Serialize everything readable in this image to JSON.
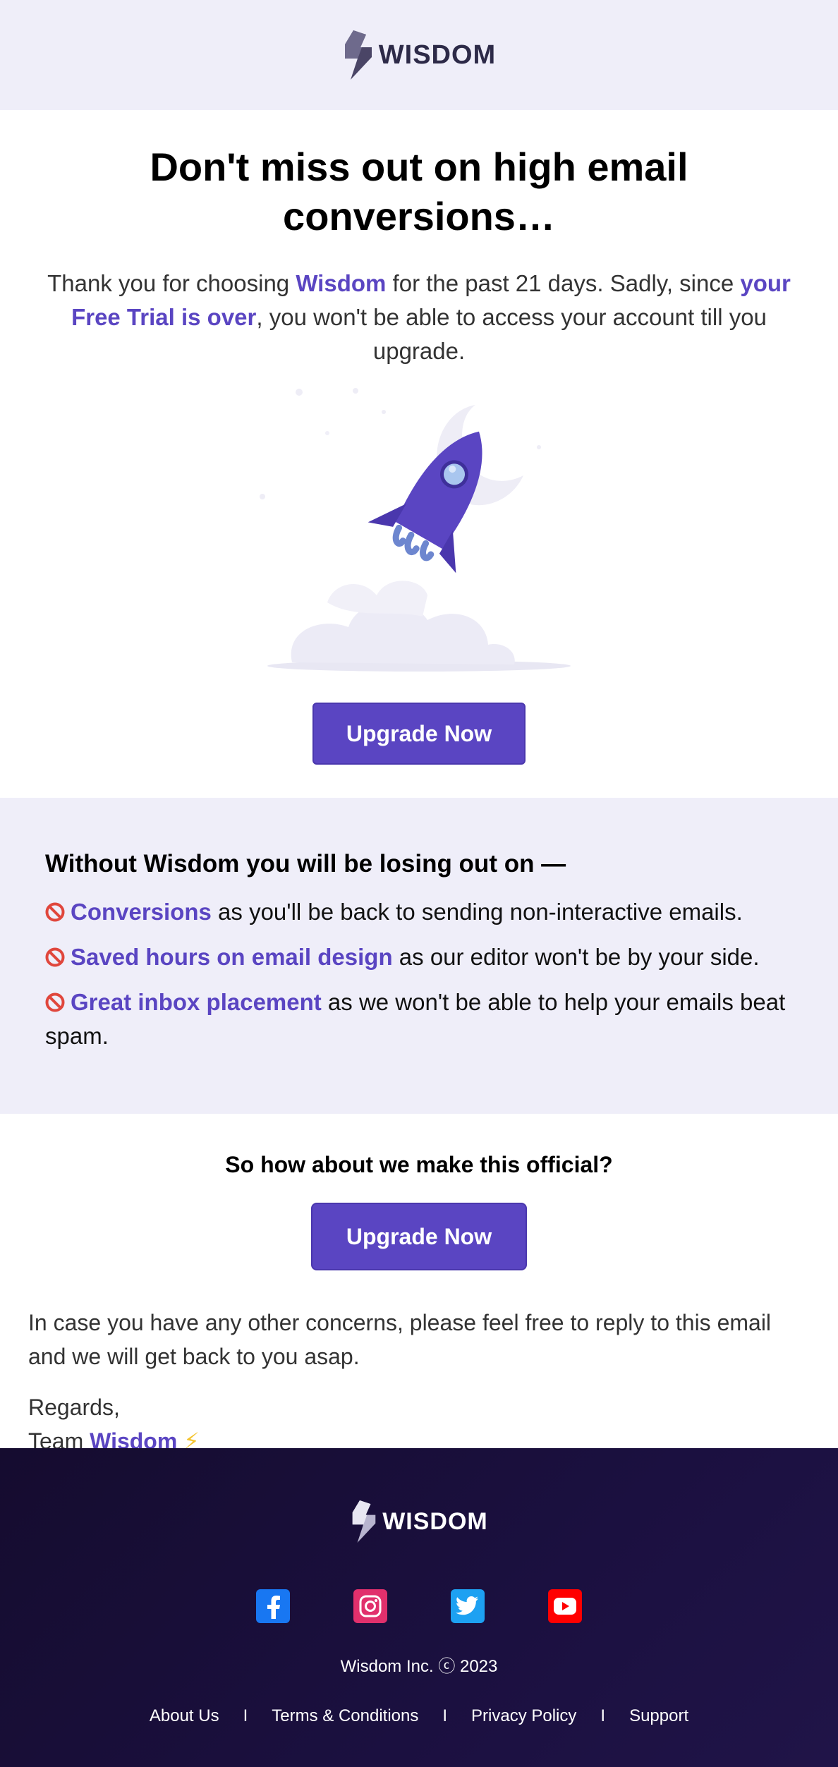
{
  "header": {
    "logo_text": "WISDOM"
  },
  "hero": {
    "title_line1": "Don't miss out on high email",
    "title_line2": "conversions…",
    "intro_part1": "Thank you for choosing ",
    "intro_brand": "Wisdom",
    "intro_part2": " for the past 21 days. Sadly, since ",
    "intro_highlight": "your Free Trial is over",
    "intro_part3": ", you won't be able to access your account till you upgrade."
  },
  "cta_primary": {
    "label": "Upgrade Now"
  },
  "losing": {
    "heading": "Without Wisdom you will be losing out on —",
    "items": [
      {
        "highlight": "Conversions",
        "text": " as you'll be back to sending non-interactive emails."
      },
      {
        "highlight": "Saved hours on email design",
        "text": " as our editor won't be by your side."
      },
      {
        "highlight": "Great inbox placement",
        "text": " as we won't be able to help your emails beat spam."
      }
    ]
  },
  "official": {
    "heading": "So how about we make this official?",
    "button_label": "Upgrade Now"
  },
  "concerns": {
    "text": "In case you have any other concerns, please feel free to reply to this email and we will get back to you asap."
  },
  "signoff": {
    "regards": "Regards,",
    "team_prefix": "Team ",
    "team_link": "Wisdom",
    "emoji": "⚡"
  },
  "footer": {
    "logo_text": "WISDOM",
    "socials": [
      {
        "name": "facebook",
        "color": "#1877f2"
      },
      {
        "name": "instagram",
        "color": "#e1306c"
      },
      {
        "name": "twitter",
        "color": "#1da1f2"
      },
      {
        "name": "youtube",
        "color": "#ff0000"
      }
    ],
    "copyright": "Wisdom Inc. ⓒ 2023",
    "links": [
      "About Us",
      "Terms & Conditions",
      "Privacy Policy",
      "Support"
    ],
    "separator": "I"
  },
  "colors": {
    "accent": "#5a45c2",
    "header_bg": "#efeef9",
    "footer_bg": "#1b1040"
  }
}
